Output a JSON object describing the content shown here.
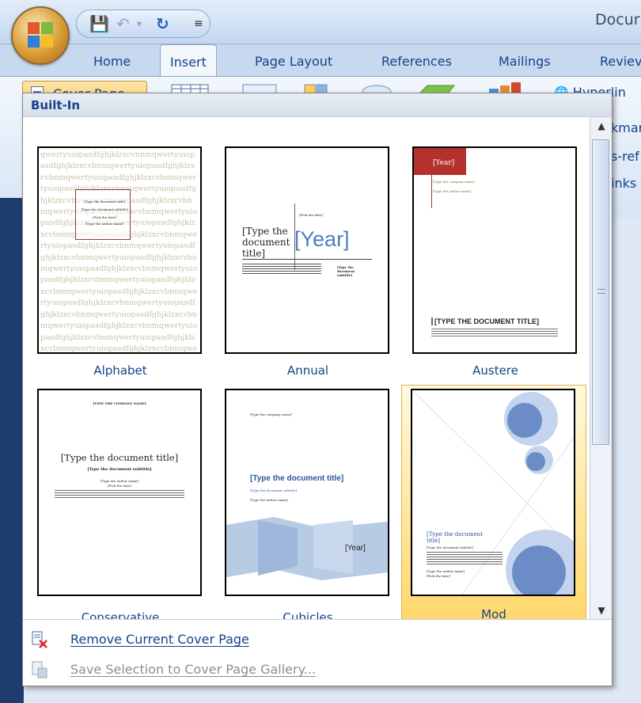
{
  "titlebar": {
    "document_title": "Docur"
  },
  "quick_access": {
    "save_icon": "save-icon",
    "undo_icon": "undo-icon",
    "redo_icon": "redo-icon",
    "customize_icon": "customize-qat-icon"
  },
  "tabs": [
    {
      "label": "Home"
    },
    {
      "label": "Insert"
    },
    {
      "label": "Page Layout"
    },
    {
      "label": "References"
    },
    {
      "label": "Mailings"
    },
    {
      "label": "Reviev"
    }
  ],
  "ribbon": {
    "cover_page_label": "Cover Page",
    "hyperlink_label": "Hyperlin",
    "peek_bookmark": "kmar",
    "peek_crossref": "s-ref",
    "peek_links": "inks"
  },
  "gallery": {
    "header": "Built-In",
    "items": [
      {
        "name": "Alphabet"
      },
      {
        "name": "Annual"
      },
      {
        "name": "Austere"
      },
      {
        "name": "Conservative"
      },
      {
        "name": "Cubicles"
      },
      {
        "name": "Mod"
      }
    ],
    "thumb_text": {
      "alphabet_lorem": "qwertyuiopasdfghjklzxcvbnmqwertyuiopasdfghjklzxcvbnmqwertyuiopasdfghjklzxcvbnmqwertyuiopasdfghjklzxcvbnmqwertyuiopasdfghjklzxcvbnmqwertyuiopasdfghjklzxcvbnmqwertyuiopasdfghjklzxcvbnmqwertyuiopasdfghjklzxcvbnmqwertyuiopasdfghjklzxcvbnmqwertyuiopasdfghjklzxcvbnmqwertyuiopasdfghjklzxcvbnmqwertyuiopasdfghjklzxcvbnmqwertyuiopasdfghjklzxcvbnmqwertyuiopasdfghjklzxcvbnmqwertyuiopasdfghjklzxcvbnmqwertyuiopasdfghjklzxcvbnmqwertyuiopasdfghjklzxcvbnmqwertyuiopasdfghjklzxcvbnmqwertyuiopasdfghjklzxcvbnmqwertyuiopasdfghjklzxcvbnmqwertyuiopasdfghjklzxcvbnmqwertyuiopasdfghjklzxcvbnmqwertyuiopasdfghjklzxcvbnmqwertyuiopasdfghjklzxcvbnmqwertyuiopasdfghjklzxcvbnmqwertyuiopasdfghjklzxcvbnm",
      "alphabet_title": "[Type the document title]",
      "alphabet_subtitle": "[Type the document subtitle]",
      "alphabet_date": "[Pick the date]",
      "alphabet_author": "[Type the author name]",
      "annual_title": "[Type the document title]",
      "annual_date": "[Pick the date]",
      "annual_year": "[Year]",
      "annual_subtitle": "[Type the document subtitle]",
      "austere_year": "[Year]",
      "austere_company": "[Type the company name]",
      "austere_author": "[Type the author name]",
      "austere_title": "[TYPE THE DOCUMENT TITLE]",
      "conservative_company": "[TYPE THE COMPANY NAME]",
      "conservative_title": "[Type the document title]",
      "conservative_subtitle": "[Type the document subtitle]",
      "conservative_author": "[Type the author name]",
      "conservative_date": "[Pick the date]",
      "cubicles_company": "[Type the company name]",
      "cubicles_title": "[Type the document title]",
      "cubicles_subtitle": "[Type the document subtitle]",
      "cubicles_author": "[Type the author name]",
      "cubicles_year": "[Year]",
      "mod_title": "[Type the document title]",
      "mod_subtitle": "[Type the document subtitle]",
      "mod_author": "[Type the author name]",
      "mod_date": "[Pick the date]"
    }
  },
  "menu": {
    "remove_label": "Remove Current Cover Page",
    "save_label": "Save Selection to Cover Page Gallery..."
  },
  "colors": {
    "ribbon_blue": "#15428b",
    "selected_gold": "#ffd76b",
    "austere_red": "#b5322c",
    "mod_blue": "#6b8cc7"
  }
}
